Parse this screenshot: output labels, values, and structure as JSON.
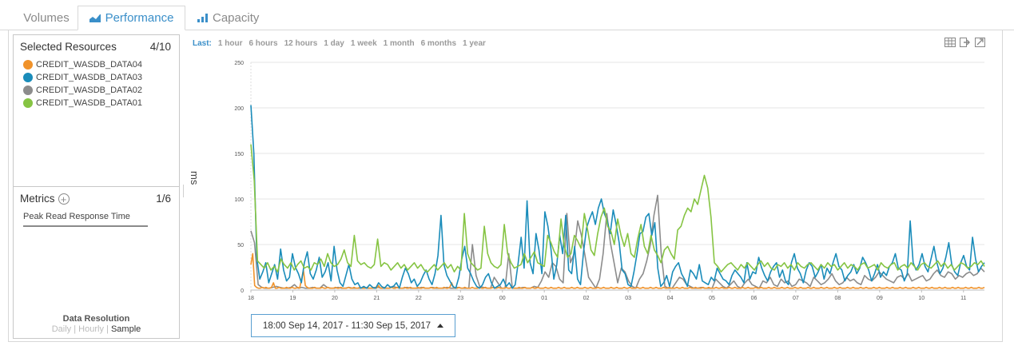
{
  "tabs": [
    {
      "label": "Volumes",
      "icon": "none"
    },
    {
      "label": "Performance",
      "icon": "area-chart-icon"
    },
    {
      "label": "Capacity",
      "icon": "bar-chart-icon"
    }
  ],
  "resources": {
    "title": "Selected Resources",
    "count": "4/10",
    "items": [
      {
        "label": "CREDIT_WASDB_DATA04",
        "color": "#f0922a"
      },
      {
        "label": "CREDIT_WASDB_DATA03",
        "color": "#1a8cba"
      },
      {
        "label": "CREDIT_WASDB_DATA02",
        "color": "#8c8c8c"
      },
      {
        "label": "CREDIT_WASDB_DATA01",
        "color": "#86c443"
      }
    ]
  },
  "metrics": {
    "title": "Metrics",
    "count": "1/6",
    "items": [
      "Peak Read Response Time"
    ]
  },
  "resolution": {
    "title": "Data Resolution",
    "options": [
      "Daily",
      "Hourly",
      "Sample"
    ],
    "selected": "Sample"
  },
  "time_range": {
    "label": "Last:",
    "options": [
      "1 hour",
      "6 hours",
      "12 hours",
      "1 day",
      "1 week",
      "1 month",
      "6 months",
      "1 year"
    ]
  },
  "date_range": "18:00 Sep 14, 2017 - 11:30 Sep 15, 2017",
  "toolbar_icons": [
    "table-icon",
    "export-icon",
    "expand-icon"
  ],
  "chart_data": {
    "type": "line",
    "title": "",
    "ylabel": "ms",
    "xlabel": "",
    "ylim": [
      0,
      250
    ],
    "yticks": [
      0,
      50,
      100,
      150,
      200,
      250
    ],
    "xticks": [
      "18",
      "19",
      "20",
      "21",
      "22",
      "23",
      "00",
      "01",
      "02",
      "03",
      "04",
      "05",
      "06",
      "07",
      "08",
      "09",
      "10",
      "11"
    ],
    "x_start_hour": 18,
    "x_end_hour": 35.5,
    "sample_interval_hours": 0.125,
    "grid": true,
    "legend": "none",
    "series": [
      {
        "name": "CREDIT_WASDB_DATA04",
        "color": "#f0922a",
        "values": [
          28,
          40,
          5,
          3,
          2,
          2,
          3,
          2,
          3,
          2,
          2,
          3,
          8,
          2,
          2,
          3,
          2,
          2,
          2,
          3,
          2,
          2,
          3,
          2,
          2,
          3,
          2,
          12,
          22,
          5,
          3,
          2,
          2,
          2,
          3,
          2,
          2,
          2,
          3,
          2,
          2,
          3,
          2,
          2,
          2,
          3,
          2,
          2,
          3,
          2,
          2,
          2,
          3,
          2,
          2,
          3,
          2,
          2,
          3,
          2,
          2,
          2,
          3,
          2,
          2,
          2,
          3,
          2,
          5,
          2,
          2,
          3,
          2,
          2,
          2,
          3,
          2,
          2,
          3,
          2,
          2,
          2,
          3,
          2,
          2,
          3,
          2,
          2,
          2,
          3,
          2,
          2,
          3,
          2,
          2,
          2,
          3,
          2,
          2,
          3,
          2,
          2,
          2,
          3,
          2,
          2,
          3,
          8,
          3,
          2,
          2,
          3,
          2,
          2,
          3,
          2,
          2,
          2,
          3,
          2,
          2,
          2,
          3,
          2,
          2,
          3,
          2,
          2,
          2,
          3,
          2,
          2,
          3,
          2,
          2,
          2,
          3,
          2,
          2,
          3,
          2,
          2,
          2,
          3,
          2,
          2,
          3,
          2,
          2,
          2,
          3,
          2,
          2,
          3,
          2,
          2,
          2,
          3,
          2,
          2,
          3,
          2,
          2,
          2,
          3,
          2,
          2,
          3,
          2,
          2,
          2,
          3,
          2,
          2,
          3,
          2,
          2,
          2,
          3,
          2,
          2,
          3,
          2,
          2,
          2,
          3,
          2,
          2,
          3,
          2,
          2,
          2,
          3,
          2,
          2,
          3,
          2,
          2,
          2,
          3,
          2,
          2,
          3,
          2,
          2,
          2,
          3,
          2,
          2,
          3,
          2,
          2,
          2,
          3,
          2,
          2,
          3,
          2,
          2,
          2,
          3,
          2,
          2,
          3,
          2,
          2,
          2,
          3,
          2,
          2,
          3,
          2,
          2,
          2,
          3,
          2,
          2,
          3,
          2,
          2,
          2,
          3,
          2,
          2,
          3,
          2,
          2,
          2,
          3,
          2,
          2,
          3,
          2,
          2,
          2,
          3,
          2,
          2,
          3,
          2,
          2,
          2,
          3,
          2,
          2,
          3,
          2,
          2,
          2,
          3,
          2,
          2,
          3,
          2,
          2,
          2,
          3,
          2,
          2,
          3,
          2,
          2,
          2,
          3,
          2,
          2,
          3,
          2,
          2,
          2,
          3,
          2,
          2,
          3,
          2,
          2,
          2,
          3,
          2,
          2,
          3,
          2,
          2,
          2,
          3,
          2,
          2,
          3,
          2,
          2,
          2,
          3,
          2,
          2,
          3,
          2,
          2,
          2,
          3,
          2,
          2,
          3,
          2,
          2,
          2,
          3,
          2,
          2,
          3,
          2,
          2,
          2,
          3,
          2,
          2,
          3,
          2,
          2,
          2,
          3,
          2,
          2,
          3,
          2,
          2,
          2,
          3,
          2,
          2,
          3,
          2,
          2,
          2,
          3,
          2,
          2,
          3,
          2,
          2,
          2,
          3,
          2,
          2,
          3,
          2,
          2,
          2,
          3,
          2,
          2,
          3,
          2,
          2,
          2,
          3,
          2,
          2,
          3,
          2,
          2,
          2,
          3,
          2,
          2,
          3,
          2,
          2,
          2,
          3,
          2,
          2,
          3
        ]
      },
      {
        "name": "CREDIT_WASDB_DATA03",
        "color": "#1a8cba",
        "values": [
          203,
          150,
          35,
          12,
          20,
          30,
          8,
          18,
          28,
          12,
          45,
          22,
          10,
          14,
          40,
          25,
          18,
          8,
          30,
          42,
          18,
          12,
          22,
          36,
          14,
          20,
          30,
          10,
          48,
          22,
          8,
          4,
          16,
          28,
          12,
          6,
          8,
          2,
          4,
          2,
          6,
          3,
          2,
          8,
          4,
          2,
          6,
          3,
          4,
          8,
          2,
          14,
          24,
          18,
          8,
          12,
          4,
          8,
          16,
          22,
          12,
          6,
          18,
          38,
          82,
          28,
          16,
          10,
          4,
          2,
          14,
          34,
          48,
          24,
          18,
          10,
          4,
          2,
          6,
          14,
          18,
          8,
          2,
          4,
          6,
          12,
          4,
          8,
          2,
          6,
          30,
          58,
          24,
          98,
          30,
          18,
          62,
          44,
          18,
          86,
          70,
          46,
          12,
          28,
          60,
          40,
          82,
          22,
          18,
          48,
          12,
          6,
          42,
          68,
          78,
          86,
          72,
          90,
          100,
          84,
          76,
          62,
          88,
          72,
          52,
          22,
          18,
          6,
          4,
          20,
          40,
          62,
          64,
          80,
          84,
          60,
          74,
          24,
          4,
          8,
          16,
          4,
          20,
          26,
          30,
          18,
          12,
          4,
          22,
          18,
          12,
          28,
          10,
          8,
          6,
          14,
          10,
          24,
          18,
          12,
          10,
          6,
          16,
          22,
          18,
          14,
          8,
          30,
          12,
          20,
          18,
          36,
          24,
          16,
          10,
          20,
          26,
          30,
          14,
          22,
          10,
          6,
          30,
          40,
          24,
          18,
          8,
          22,
          30,
          26,
          14,
          20,
          28,
          12,
          24,
          18,
          30,
          40,
          26,
          22,
          10,
          16,
          20,
          28,
          18,
          24,
          36,
          30,
          22,
          10,
          18,
          28,
          14,
          20,
          16,
          26,
          30,
          40,
          24,
          22,
          10,
          18,
          76,
          30,
          22,
          28,
          40,
          26,
          20,
          34,
          48,
          30,
          18,
          24,
          36,
          52,
          28,
          20,
          16,
          30,
          38,
          26,
          22,
          58,
          34,
          20,
          26,
          30
        ]
      },
      {
        "name": "CREDIT_WASDB_DATA02",
        "color": "#8c8c8c",
        "values": [
          65,
          52,
          6,
          3,
          2,
          2,
          3,
          4,
          3,
          2,
          2,
          3,
          6,
          2,
          3,
          2,
          2,
          3,
          2,
          2,
          6,
          3,
          2,
          2,
          3,
          2,
          2,
          3,
          2,
          2,
          2,
          3,
          2,
          2,
          2,
          3,
          2,
          2,
          2,
          4,
          3,
          2,
          2,
          3,
          2,
          2,
          2,
          3,
          2,
          2,
          3,
          2,
          2,
          2,
          3,
          2,
          2,
          3,
          2,
          2,
          2,
          50,
          16,
          4,
          3,
          2,
          2,
          14,
          8,
          2,
          2,
          40,
          2,
          2,
          2,
          3,
          2,
          2,
          4,
          3,
          10,
          20,
          14,
          30,
          26,
          12,
          8,
          84,
          30,
          40,
          76,
          60,
          38,
          14,
          8,
          2,
          12,
          40,
          84,
          52,
          30,
          8,
          24,
          20,
          10,
          4,
          2,
          12,
          18,
          32,
          50,
          82,
          104,
          40,
          4,
          2,
          2,
          8,
          14,
          12,
          6,
          4,
          2,
          2,
          3,
          2,
          2,
          2,
          12,
          8,
          4,
          2,
          6,
          10,
          4,
          2,
          8,
          12,
          6,
          4,
          2,
          10,
          8,
          14,
          6,
          4,
          12,
          8,
          10,
          4,
          6,
          12,
          10,
          8,
          4,
          14,
          10,
          6,
          8,
          12,
          18,
          10,
          6,
          8,
          14,
          10,
          12,
          8,
          6,
          16,
          12,
          10,
          14,
          20,
          16,
          12,
          10,
          8,
          14,
          16,
          12,
          18,
          10,
          12,
          14,
          16,
          10,
          12,
          18,
          22,
          16,
          14,
          20,
          18,
          12,
          16,
          14,
          18,
          20,
          16,
          18,
          24,
          20
        ]
      },
      {
        "name": "CREDIT_WASDB_DATA01",
        "color": "#86c443",
        "values": [
          160,
          120,
          32,
          28,
          24,
          30,
          22,
          26,
          20,
          34,
          28,
          24,
          30,
          22,
          28,
          32,
          24,
          26,
          22,
          30,
          28,
          34,
          26,
          40,
          30,
          26,
          28,
          34,
          44,
          30,
          26,
          60,
          32,
          28,
          30,
          26,
          24,
          28,
          56,
          26,
          30,
          28,
          22,
          26,
          30,
          24,
          28,
          22,
          26,
          30,
          24,
          28,
          22,
          20,
          24,
          28,
          22,
          26,
          30,
          24,
          28,
          20,
          26,
          22,
          84,
          40,
          30,
          26,
          22,
          24,
          70,
          40,
          30,
          26,
          24,
          28,
          72,
          40,
          30,
          24,
          26,
          28,
          40,
          30,
          36,
          42,
          30,
          28,
          26,
          60,
          52,
          42,
          36,
          78,
          48,
          36,
          40,
          60,
          54,
          46,
          84,
          66,
          44,
          38,
          62,
          80,
          90,
          70,
          64,
          50,
          78,
          60,
          48,
          62,
          40,
          36,
          56,
          72,
          48,
          40,
          60,
          44,
          38,
          30,
          44,
          48,
          40,
          34,
          66,
          70,
          82,
          90,
          86,
          100,
          94,
          110,
          126,
          112,
          80,
          30,
          26,
          20,
          24,
          28,
          30,
          26,
          22,
          28,
          24,
          30,
          26,
          22,
          28,
          32,
          26,
          30,
          24,
          22,
          28,
          26,
          30,
          24,
          28,
          22,
          30,
          26,
          24,
          28,
          30,
          26,
          22,
          28,
          24,
          30,
          26,
          28,
          22,
          26,
          30,
          24,
          28,
          26,
          22,
          28,
          30,
          24,
          26,
          28,
          22,
          30,
          26,
          24,
          28,
          30,
          22,
          26,
          28,
          24,
          30,
          26,
          22,
          28,
          30,
          26,
          24,
          28,
          32,
          26,
          30,
          24,
          28,
          22,
          26,
          30,
          28,
          24,
          26,
          30,
          28,
          32,
          26
        ]
      }
    ]
  }
}
